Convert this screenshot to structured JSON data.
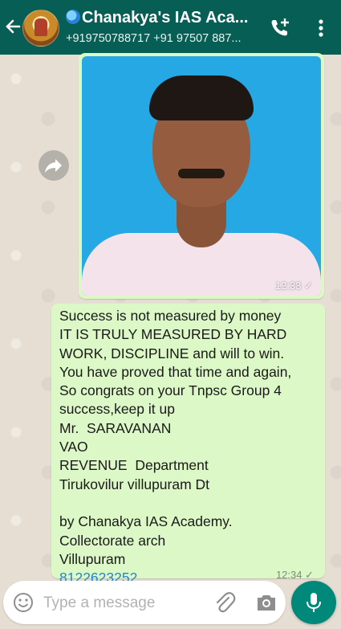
{
  "header": {
    "title": "Chanakya's IAS Aca...",
    "subtitle": "+919750788717 +91 97507 887..."
  },
  "image_message": {
    "time": "12:33 ✓"
  },
  "text_message": {
    "lines": [
      "Success is not measured by money",
      "IT IS TRULY MEASURED BY HARD",
      "WORK, DISCIPLINE and will to win.",
      "You have proved that time and again,",
      "So congrats on your Tnpsc Group 4",
      "success,keep it up",
      "Mr.  SARAVANAN",
      "VAO",
      "REVENUE  Department",
      "Tirukovilur villupuram Dt",
      "",
      "by Chanakya IAS Academy.",
      "Collectorate arch",
      "Villupuram"
    ],
    "phone_link": "8122623252",
    "time": "12:34 ✓"
  },
  "composer": {
    "placeholder": "Type a message"
  },
  "colors": {
    "header": "#075e54",
    "bubble_out": "#dcf8c6",
    "accent": "#00897b",
    "link": "#1e88c9"
  }
}
